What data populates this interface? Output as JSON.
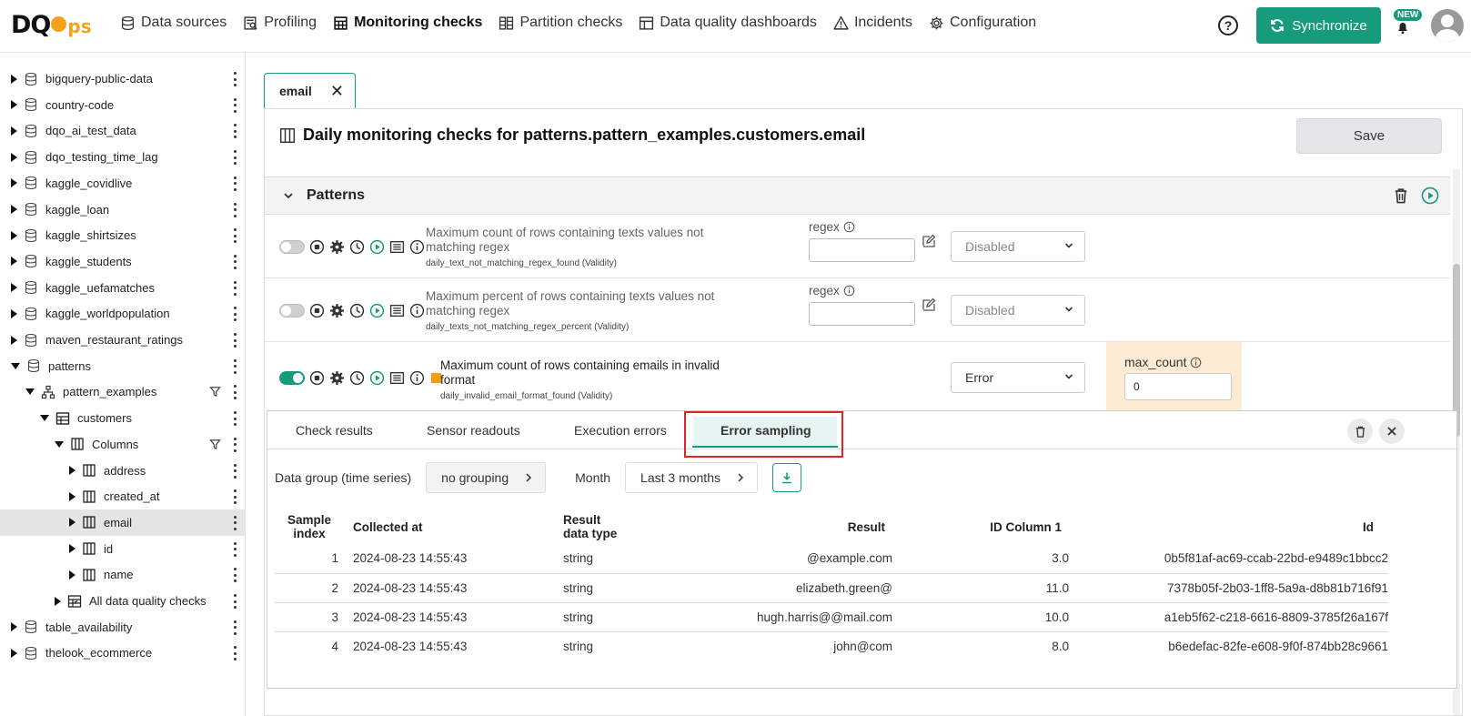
{
  "app": {
    "logo_main": "D",
    "logo_q": "Q",
    "logo_ops": "ps"
  },
  "nav": [
    {
      "label": "Data sources",
      "icon": "database-icon"
    },
    {
      "label": "Profiling",
      "icon": "profiling-icon"
    },
    {
      "label": "Monitoring checks",
      "icon": "table-icon",
      "active": true
    },
    {
      "label": "Partition checks",
      "icon": "partition-icon"
    },
    {
      "label": "Data quality dashboards",
      "icon": "dashboard-icon"
    },
    {
      "label": "Incidents",
      "icon": "warning-icon"
    },
    {
      "label": "Configuration",
      "icon": "gear-icon"
    }
  ],
  "header": {
    "help": "?",
    "sync_label": "Synchronize",
    "new_badge": "NEW"
  },
  "sidebar": {
    "items": [
      {
        "label": "bigquery-public-data"
      },
      {
        "label": "country-code"
      },
      {
        "label": "dqo_ai_test_data"
      },
      {
        "label": "dqo_testing_time_lag"
      },
      {
        "label": "kaggle_covidlive"
      },
      {
        "label": "kaggle_loan"
      },
      {
        "label": "kaggle_shirtsizes"
      },
      {
        "label": "kaggle_students"
      },
      {
        "label": "kaggle_uefamatches"
      },
      {
        "label": "kaggle_worldpopulation"
      },
      {
        "label": "maven_restaurant_ratings"
      },
      {
        "label": "patterns"
      },
      {
        "label": "pattern_examples"
      },
      {
        "label": "customers"
      },
      {
        "label": "Columns"
      },
      {
        "label": "address"
      },
      {
        "label": "created_at"
      },
      {
        "label": "email"
      },
      {
        "label": "id"
      },
      {
        "label": "name"
      },
      {
        "label": "All data quality checks"
      },
      {
        "label": "table_availability"
      },
      {
        "label": "thelook_ecommerce"
      }
    ]
  },
  "tab": {
    "label": "email",
    "close": "✕"
  },
  "panel": {
    "title": "Daily monitoring checks for patterns.pattern_examples.customers.email",
    "save_label": "Save",
    "group_name": "Patterns"
  },
  "checks": [
    {
      "description": "Maximum count of rows containing texts values not matching regex",
      "code": "daily_text_not_matching_regex_found (Validity)",
      "param_label": "regex",
      "severity": "Disabled",
      "enabled": false
    },
    {
      "description": "Maximum percent of rows containing texts values not matching regex",
      "code": "daily_texts_not_matching_regex_percent (Validity)",
      "param_label": "regex",
      "severity": "Disabled",
      "enabled": false
    },
    {
      "description": "Maximum count of rows containing emails in invalid format",
      "code": "daily_invalid_email_format_found (Validity)",
      "severity": "Error",
      "enabled": true,
      "error_param_label": "max_count",
      "error_param_value": "0"
    }
  ],
  "sampling": {
    "tabs": [
      "Check results",
      "Sensor readouts",
      "Execution errors",
      "Error sampling"
    ],
    "active_tab": "Error sampling",
    "data_group_label": "Data group (time series)",
    "data_group_value": "no grouping",
    "month_label": "Month",
    "month_value": "Last 3 months",
    "columns": {
      "sample_index_1": "Sample",
      "sample_index_2": "index",
      "collected_at": "Collected at",
      "result_type_1": "Result",
      "result_type_2": "data type",
      "result": "Result",
      "id_column": "ID Column 1",
      "id": "Id"
    },
    "rows": [
      {
        "index": "1",
        "collected_at": "2024-08-23 14:55:43",
        "type": "string",
        "result": "@example.com",
        "id_col": "3.0",
        "id": "0b5f81af-ac69-ccab-22bd-e9489c1bbcc2"
      },
      {
        "index": "2",
        "collected_at": "2024-08-23 14:55:43",
        "type": "string",
        "result": "elizabeth.green@",
        "id_col": "11.0",
        "id": "7378b05f-2b03-1ff8-5a9a-d8b81b716f91"
      },
      {
        "index": "3",
        "collected_at": "2024-08-23 14:55:43",
        "type": "string",
        "result": "hugh.harris@@mail.com",
        "id_col": "10.0",
        "id": "a1eb5f62-c218-6616-8809-3785f26a167f"
      },
      {
        "index": "4",
        "collected_at": "2024-08-23 14:55:43",
        "type": "string",
        "result": "john@com",
        "id_col": "8.0",
        "id": "b6edefac-82fe-e608-9f0f-874bb28c9661"
      }
    ]
  },
  "colors": {
    "accent": "#169b7d",
    "highlight": "#e02424",
    "warning_param_bg": "#fdebd3",
    "severity_square": "#f59e0b"
  }
}
